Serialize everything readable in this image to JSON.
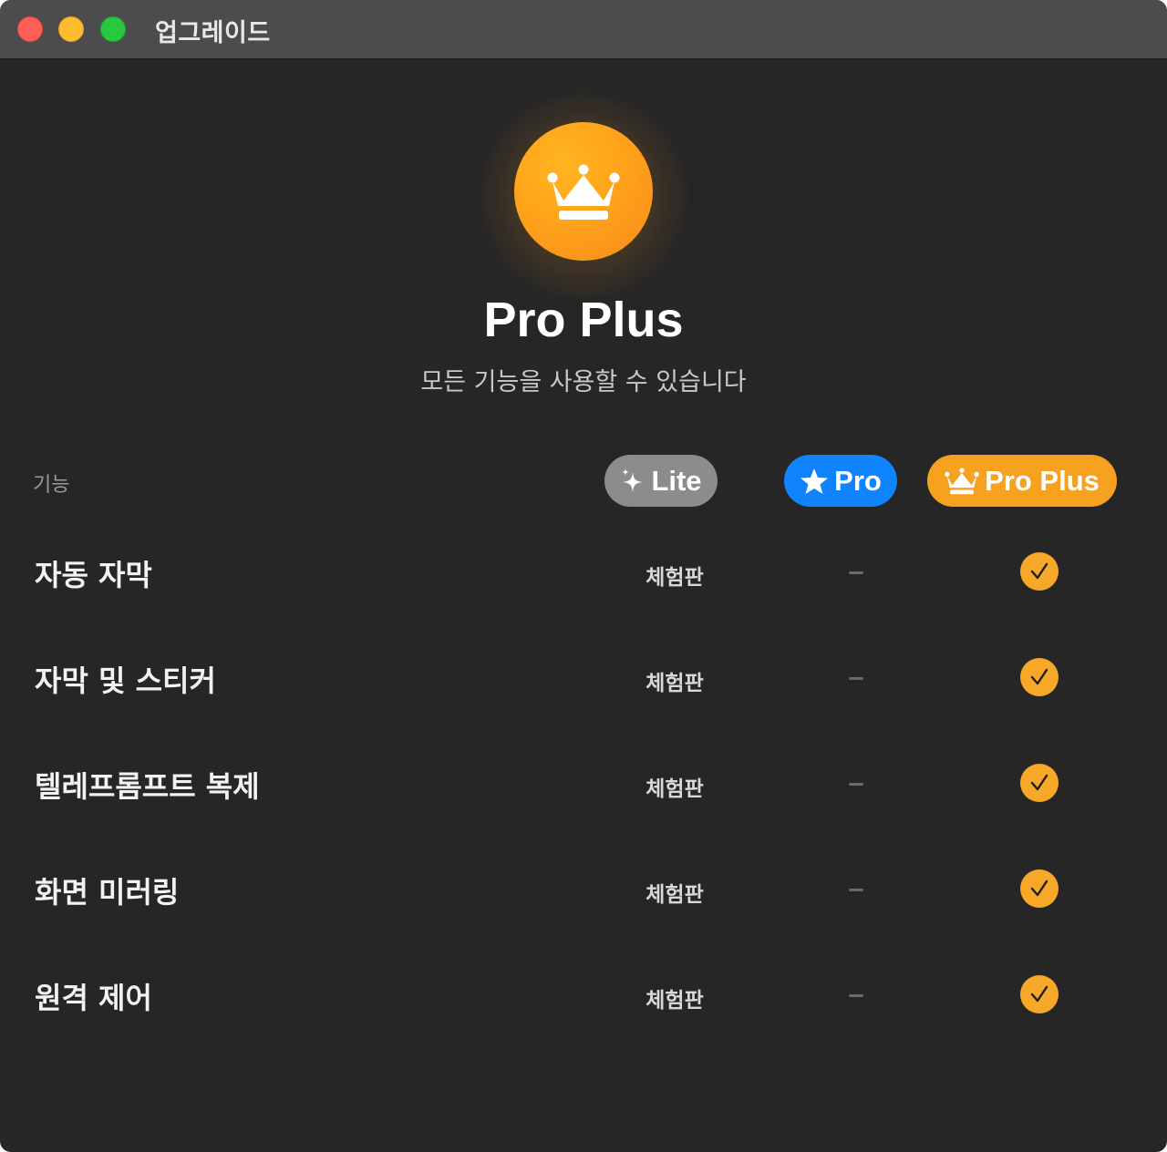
{
  "window": {
    "title": "업그레이드"
  },
  "hero": {
    "icon": "crown-icon",
    "title": "Pro Plus",
    "subtitle": "모든 기능을 사용할 수 있습니다"
  },
  "table": {
    "feature_header": "기능",
    "plans": [
      {
        "label": "Lite",
        "icon": "sparkles-icon",
        "color": "#8c8c8c"
      },
      {
        "label": "Pro",
        "icon": "star-icon",
        "color": "#1083fe"
      },
      {
        "label": "Pro Plus",
        "icon": "crown-icon",
        "color": "#f7a121"
      }
    ],
    "rows": [
      {
        "feature": "자동 자막",
        "lite": "체험판",
        "pro": "dash",
        "pro_plus": "check"
      },
      {
        "feature": "자막 및 스티커",
        "lite": "체험판",
        "pro": "dash",
        "pro_plus": "check"
      },
      {
        "feature": "텔레프롬프트 복제",
        "lite": "체험판",
        "pro": "dash",
        "pro_plus": "check"
      },
      {
        "feature": "화면 미러링",
        "lite": "체험판",
        "pro": "dash",
        "pro_plus": "check"
      },
      {
        "feature": "원격 제어",
        "lite": "체험판",
        "pro": "dash",
        "pro_plus": "check"
      }
    ]
  },
  "colors": {
    "background": "#262626",
    "accent_orange": "#f7a121",
    "accent_blue": "#1083fe",
    "lite_gray": "#8c8c8c"
  }
}
